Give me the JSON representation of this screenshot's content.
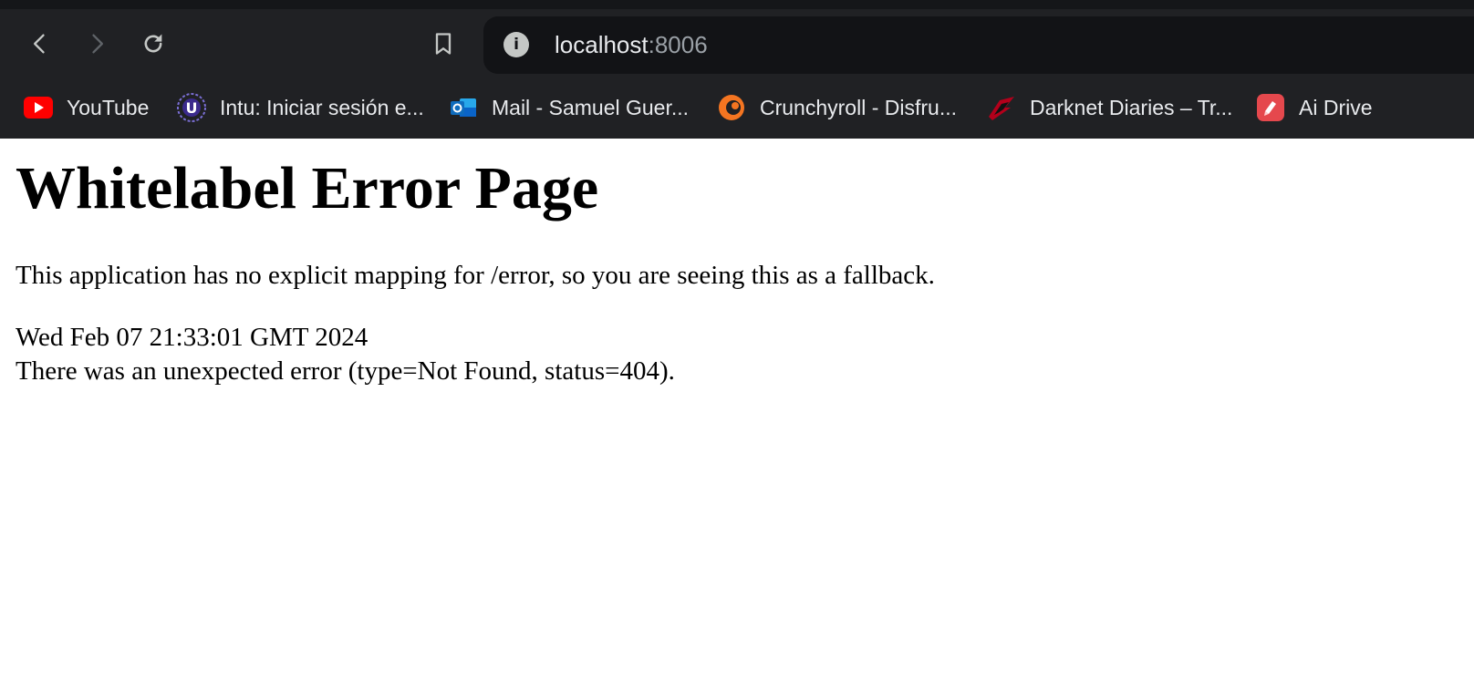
{
  "browser": {
    "address_bar": {
      "host": "localhost",
      "port": ":8006"
    },
    "bookmarks": [
      {
        "label": "YouTube",
        "icon": "youtube-icon"
      },
      {
        "label": "Intu: Iniciar sesión e...",
        "icon": "intu-icon"
      },
      {
        "label": "Mail - Samuel Guer...",
        "icon": "outlook-icon"
      },
      {
        "label": "Crunchyroll - Disfru...",
        "icon": "crunchyroll-icon"
      },
      {
        "label": "Darknet Diaries – Tr...",
        "icon": "darknet-diaries-icon"
      },
      {
        "label": "Ai Drive",
        "icon": "ai-drive-icon"
      }
    ],
    "colors": {
      "chrome_bg": "#202124",
      "omnibox_bg": "#121316",
      "text": "#e8eaed"
    }
  },
  "page": {
    "title": "Whitelabel Error Page",
    "description": "This application has no explicit mapping for /error, so you are seeing this as a fallback.",
    "timestamp": "Wed Feb 07 21:33:01 GMT 2024",
    "error_message": "There was an unexpected error (type=Not Found, status=404)."
  }
}
